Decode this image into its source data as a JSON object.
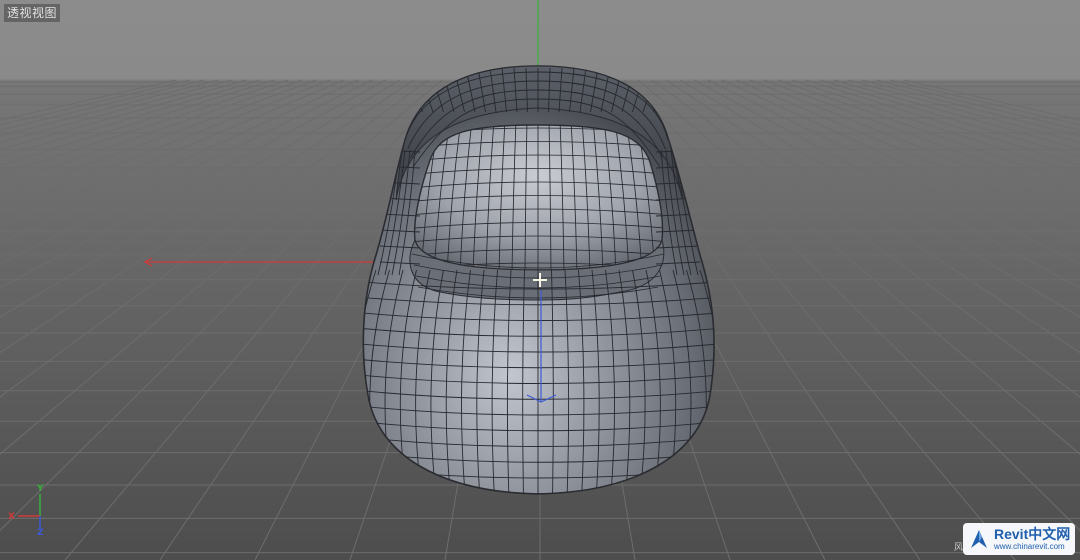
{
  "viewport": {
    "label": "透视视图",
    "background_top": "#8a8a8a",
    "background_bottom": "#4e4e4e",
    "grid_color": "#6d6d6d",
    "axis_colors": {
      "x": "#d23a3a",
      "y": "#3ab03a",
      "z": "#3b5bd6"
    }
  },
  "object": {
    "type": "subdivided-seat-shell",
    "wire_color": "#27292f",
    "surface_color": "#8f939b"
  },
  "axis_gizmo": {
    "y_label": "Y",
    "x_label": "X",
    "z_label": "Z"
  },
  "watermark": {
    "side_char": "风",
    "brand": "Revit中文网",
    "url": "www.chinarevit.com"
  },
  "icons": {
    "pivot": "crosshair-icon",
    "logo": "revit-logo-icon"
  }
}
